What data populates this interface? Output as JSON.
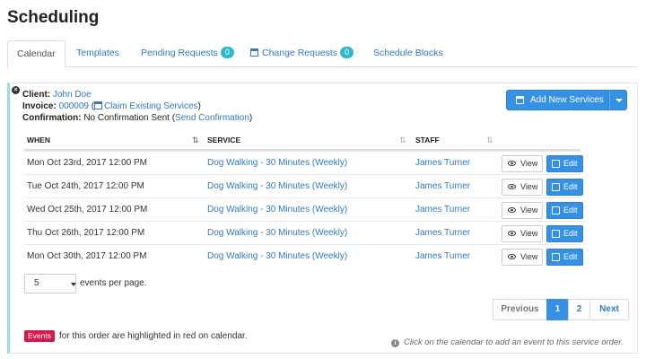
{
  "page_title": "Scheduling",
  "tabs": [
    {
      "label": "Calendar",
      "active": true
    },
    {
      "label": "Templates"
    },
    {
      "label": "Pending Requests",
      "badge": "0"
    },
    {
      "label": "Change Requests",
      "badge": "0",
      "icon": "calendar-icon"
    },
    {
      "label": "Schedule Blocks"
    }
  ],
  "order": {
    "client_label": "Client:",
    "client_name": "John Doe",
    "invoice_label": "Invoice:",
    "invoice_number": "000009",
    "claim_label": "Claim Existing Services",
    "confirmation_label": "Confirmation:",
    "confirmation_status": "No Confirmation Sent",
    "send_confirmation": "Send Confirmation"
  },
  "add_button": {
    "label": "Add New Services",
    "icon": "calendar-icon",
    "color": "#3591e4"
  },
  "table": {
    "columns": [
      "WHEN",
      "SERVICE",
      "STAFF"
    ],
    "view_label": "View",
    "edit_label": "Edit",
    "rows": [
      {
        "when": "Mon Oct 23rd, 2017 12:00 PM",
        "service": "Dog Walking - 30 Minutes (Weekly)",
        "staff": "James Turner"
      },
      {
        "when": "Tue Oct 24th, 2017 12:00 PM",
        "service": "Dog Walking - 30 Minutes (Weekly)",
        "staff": "James Turner"
      },
      {
        "when": "Wed Oct 25th, 2017 12:00 PM",
        "service": "Dog Walking - 30 Minutes (Weekly)",
        "staff": "James Turner"
      },
      {
        "when": "Thu Oct 26th, 2017 12:00 PM",
        "service": "Dog Walking - 30 Minutes (Weekly)",
        "staff": "James Turner"
      },
      {
        "when": "Mon Oct 30th, 2017 12:00 PM",
        "service": "Dog Walking - 30 Minutes (Weekly)",
        "staff": "James Turner"
      }
    ]
  },
  "per_page": {
    "value": "5",
    "label": "events per page."
  },
  "pagination": {
    "previous": "Previous",
    "pages": [
      "1",
      "2"
    ],
    "current": "1",
    "next": "Next"
  },
  "footer": {
    "events_tag": "Events",
    "events_text": "for this order are highlighted in red on calendar.",
    "hint": "Click on the calendar to add an event to this service order."
  },
  "colors": {
    "accent": "#3591e4",
    "badge": "#2fb8c9",
    "events_tag": "#d6194a",
    "panel_border": "#9fd6ef"
  }
}
